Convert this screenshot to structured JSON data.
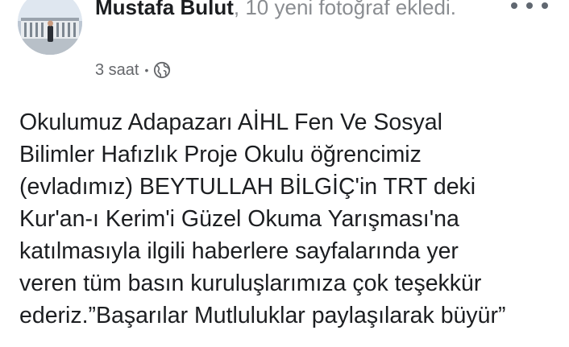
{
  "post": {
    "author": "Mustafa Bulut",
    "action": ", 10 yeni fotoğraf ekledi.",
    "time": "3 saat",
    "separator": "•",
    "privacy_icon": "globe-icon",
    "more_icon": "more-options-icon",
    "body": "Okulumuz Adapazarı AİHL Fen Ve Sosyal\nBilimler Hafızlık Proje Okulu öğrencimiz\n(evladımız) BEYTULLAH BİLGİÇ'in TRT deki\nKur'an-ı Kerim'i Güzel Okuma Yarışması'na\nkatılmasıyla ilgili haberlere sayfalarında yer\nveren tüm basın kuruluşlarımıza çok teşekkür\nederiz.”Başarılar Mutluluklar paylaşılarak büyür”"
  },
  "colors": {
    "name": "#1c1e21",
    "secondary": "#65676b",
    "background": "#ffffff"
  }
}
